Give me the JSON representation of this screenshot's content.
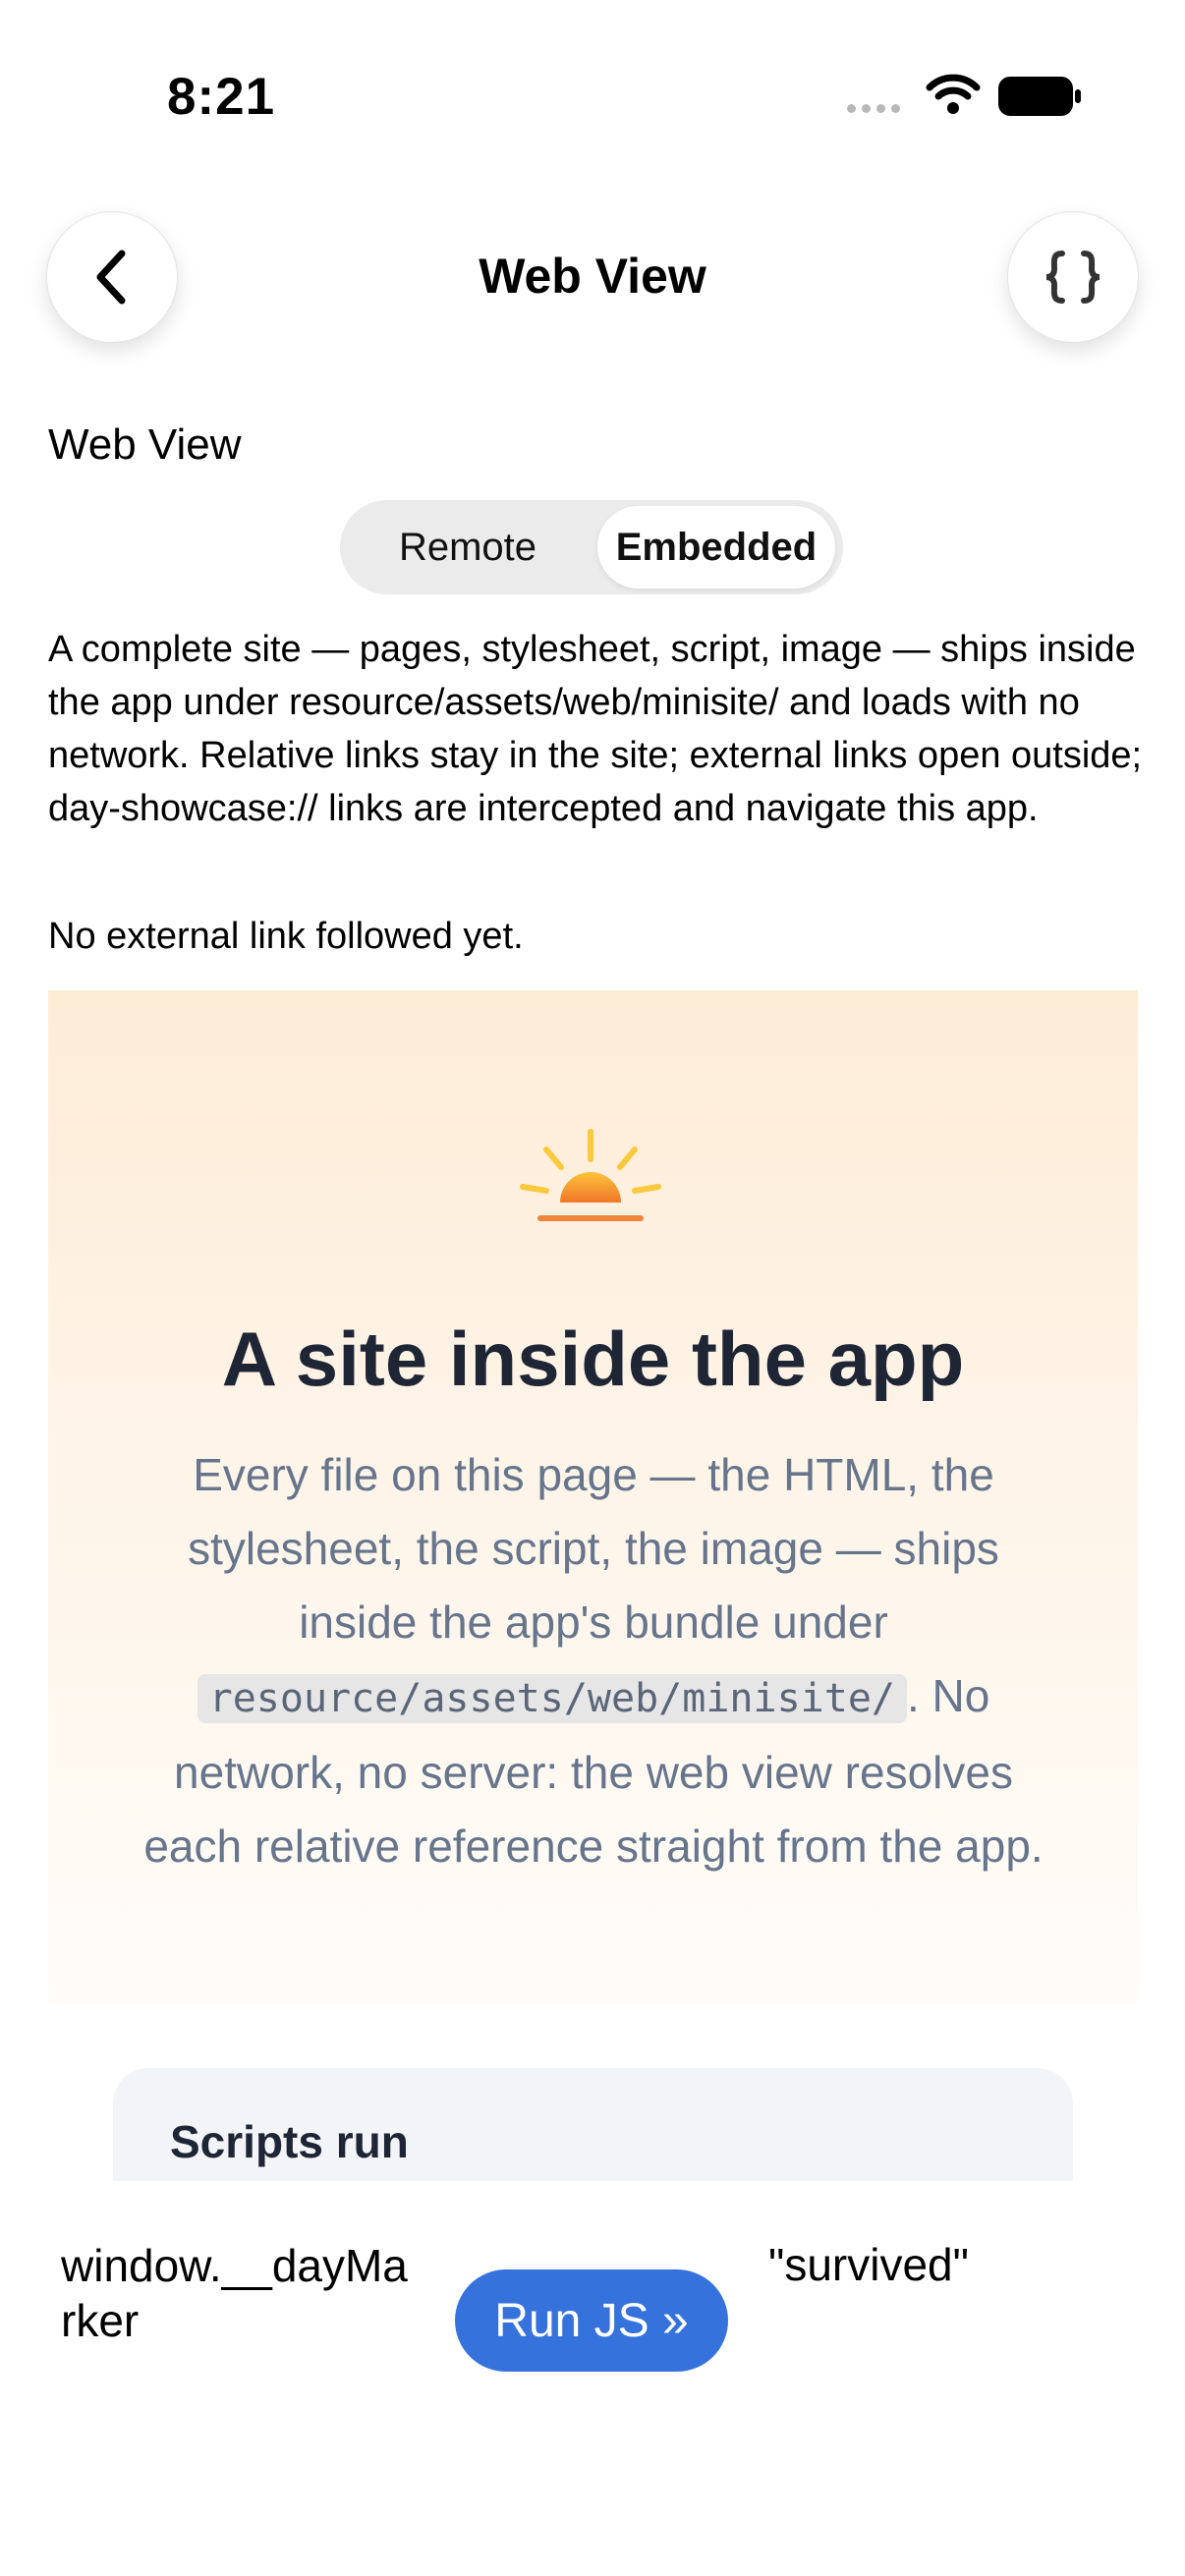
{
  "status_bar": {
    "time": "8:21"
  },
  "nav": {
    "title": "Web View"
  },
  "section_label": "Web View",
  "segmented": {
    "options": [
      "Remote",
      "Embedded"
    ],
    "selected": "Embedded"
  },
  "description": "A complete site — pages, stylesheet, script, image — ships inside the app under resource/assets/web/minisite/ and loads with no network. Relative links stay in the site; external links open outside; day-showcase:// links are intercepted and navigate this app.",
  "status_text": "No external link followed yet.",
  "webview": {
    "hero_title": "A site inside the app",
    "hero_body_before": "Every file on this page — the HTML, the stylesheet, the script, the image — ships inside the app's bundle under",
    "hero_code": "resource/assets/web/minisite/",
    "hero_body_after": ". No network, no server: the web view resolves each relative reference straight from the app.",
    "card_title": "Scripts run"
  },
  "js_bar": {
    "expression": "window.__dayMarker",
    "button_label": "Run JS »",
    "result": "\"survived\""
  },
  "colors": {
    "accent": "#3672dc",
    "hero_text": "#66758c",
    "hero_title": "#1e2535"
  },
  "icons": [
    "back-chevron-icon",
    "curly-braces-icon",
    "sunrise-icon",
    "wifi-icon",
    "battery-icon",
    "signal-icon"
  ]
}
